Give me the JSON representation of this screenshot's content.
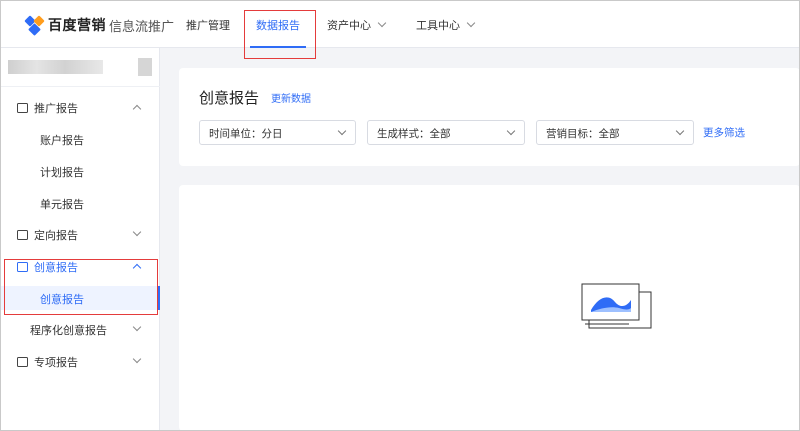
{
  "header": {
    "brand": "百度营销",
    "subtitle": "信息流推广",
    "nav": [
      {
        "label": "推广管理",
        "active": false,
        "dropdown": false
      },
      {
        "label": "数据报告",
        "active": true,
        "dropdown": false
      },
      {
        "label": "资产中心",
        "active": false,
        "dropdown": true
      },
      {
        "label": "工具中心",
        "active": false,
        "dropdown": true
      }
    ]
  },
  "sidebar": {
    "groups": [
      {
        "label": "推广报告",
        "icon": "chart-image-icon",
        "expanded": true,
        "items": [
          "账户报告",
          "计划报告",
          "单元报告"
        ]
      },
      {
        "label": "定向报告",
        "icon": "calendar-icon",
        "expanded": false,
        "items": []
      },
      {
        "label": "创意报告",
        "icon": "creative-icon",
        "expanded": true,
        "active": true,
        "items": [
          "创意报告"
        ]
      },
      {
        "label": "程序化创意报告",
        "icon": "",
        "expanded": false,
        "items": []
      },
      {
        "label": "专项报告",
        "icon": "list-icon",
        "expanded": false,
        "items": []
      }
    ],
    "active_item": "创意报告"
  },
  "main": {
    "title": "创意报告",
    "update_link": "更新数据",
    "filters": [
      {
        "label": "时间单位：分日"
      },
      {
        "label": "生成样式：全部"
      },
      {
        "label": "营销目标：全部"
      }
    ],
    "more_filters": "更多筛选"
  },
  "colors": {
    "accent": "#2f6cf6",
    "highlight_box": "#e43b3b",
    "background": "#f3f4f7"
  }
}
